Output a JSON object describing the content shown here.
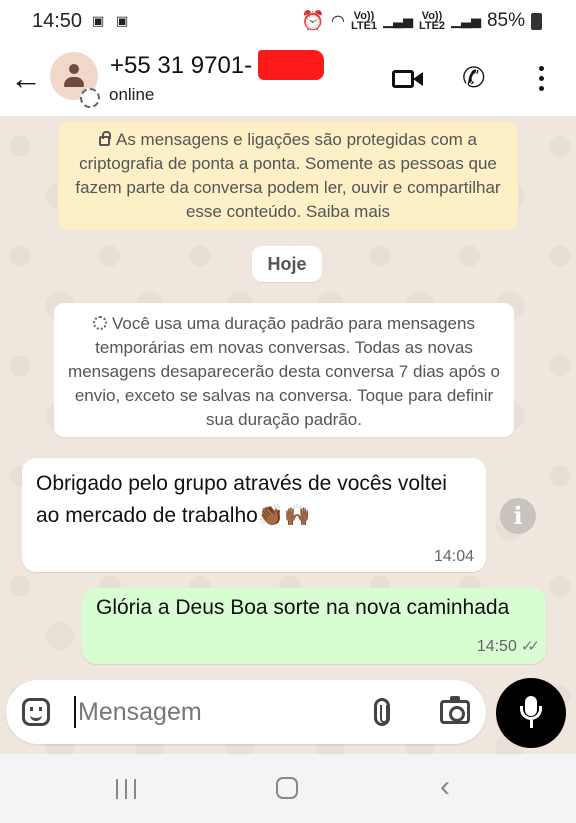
{
  "status_bar": {
    "time": "14:50",
    "left_icons": [
      "gallery-icon",
      "gallery-icon"
    ],
    "network_1": "Vo)) LTE1",
    "network_2": "Vo)) LTE2",
    "battery": "85%"
  },
  "header": {
    "back_icon": "arrow-left-icon",
    "contact_name": "+55 31 9701-",
    "contact_status": "online",
    "actions": [
      "video-call-icon",
      "voice-call-icon",
      "more-vert-icon"
    ]
  },
  "chat": {
    "encryption_notice": "As mensagens e ligações são protegidas com a criptografia de ponta a ponta. Somente as pessoas que fazem parte da conversa podem ler, ouvir e compartilhar esse conteúdo. Saiba mais",
    "date_chip": "Hoje",
    "temporary_notice": "Você usa uma duração padrão para mensagens temporárias em novas conversas. Todas as novas mensagens desaparecerão desta conversa 7 dias após o envio, exceto se salvas na conversa. Toque para definir sua duração padrão.",
    "messages": [
      {
        "direction": "incoming",
        "text": "Obrigado pelo grupo através de vocês voltei ao mercado de trabalho👏🏾🙌🏾",
        "time": "14:04"
      },
      {
        "direction": "outgoing",
        "text": "Glória a Deus Boa sorte na nova caminhada",
        "time": "14:50",
        "status": "read"
      }
    ]
  },
  "input": {
    "placeholder": "Mensagem",
    "value": ""
  },
  "colors": {
    "incoming_bubble": "#ffffff",
    "outgoing_bubble": "#d9fdd3",
    "notice_bg": "#fdefc6",
    "chat_bg": "#efe7de",
    "mic_button": "#000000"
  }
}
